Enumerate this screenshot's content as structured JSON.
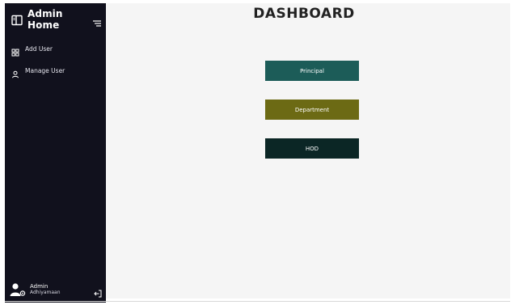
{
  "sidebar": {
    "brand": {
      "title": "Admin Home",
      "icon": "layout-panel-icon",
      "toggle_icon": "menu-lines-icon"
    },
    "items": [
      {
        "label": "Add User",
        "icon": "grid-icon"
      },
      {
        "label": "Manage User",
        "icon": "user-icon"
      }
    ],
    "footer": {
      "name": "Admin",
      "subtitle": "Adhiyamaan",
      "avatar_icon": "user-settings-icon",
      "logout_icon": "logout-icon"
    }
  },
  "main": {
    "title": "DASHBOARD",
    "tiles": [
      {
        "label": "Principal",
        "color": "#1c5c58"
      },
      {
        "label": "Department",
        "color": "#6c6a14"
      },
      {
        "label": "HOD",
        "color": "#0b2625"
      }
    ]
  },
  "colors": {
    "sidebar_bg": "#11111d",
    "main_bg": "#f5f5f5"
  }
}
